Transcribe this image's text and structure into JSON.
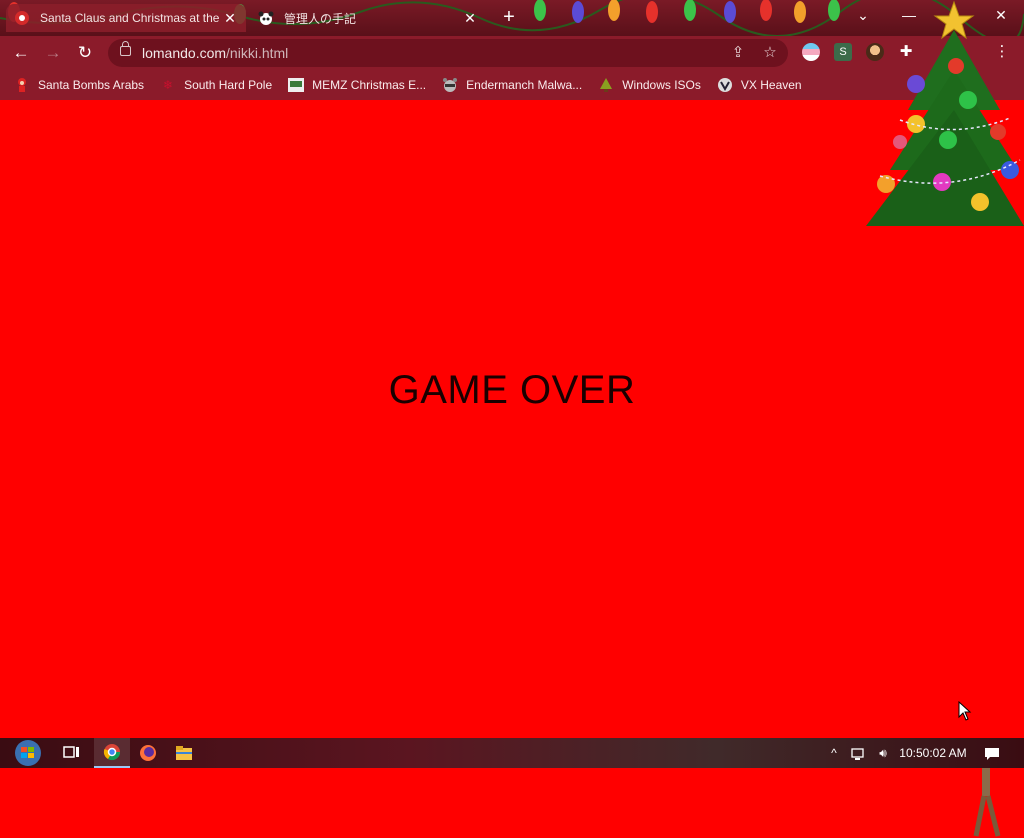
{
  "browser": {
    "tabs": [
      {
        "title": "Santa Claus and Christmas at the",
        "active": true
      },
      {
        "title": "管理人の手記",
        "active": false
      }
    ],
    "new_tab_label": "+",
    "address": {
      "host": "lomando.com",
      "path": "/nikki.html"
    },
    "bookmarks": [
      {
        "label": "Santa Bombs Arabs",
        "icon": "santa-icon"
      },
      {
        "label": "South Hard Pole",
        "icon": "snowflake-icon"
      },
      {
        "label": "MEMZ Christmas E...",
        "icon": "memz-icon"
      },
      {
        "label": "Endermanch Malwa...",
        "icon": "raccoon-icon"
      },
      {
        "label": "Windows ISOs",
        "icon": "tree-icon"
      },
      {
        "label": "VX Heaven",
        "icon": "vx-icon"
      }
    ],
    "extension_label": "S"
  },
  "page": {
    "message": "GAME OVER",
    "background_color": "#ff0000"
  },
  "taskbar": {
    "clock": "10:50:02 AM"
  }
}
